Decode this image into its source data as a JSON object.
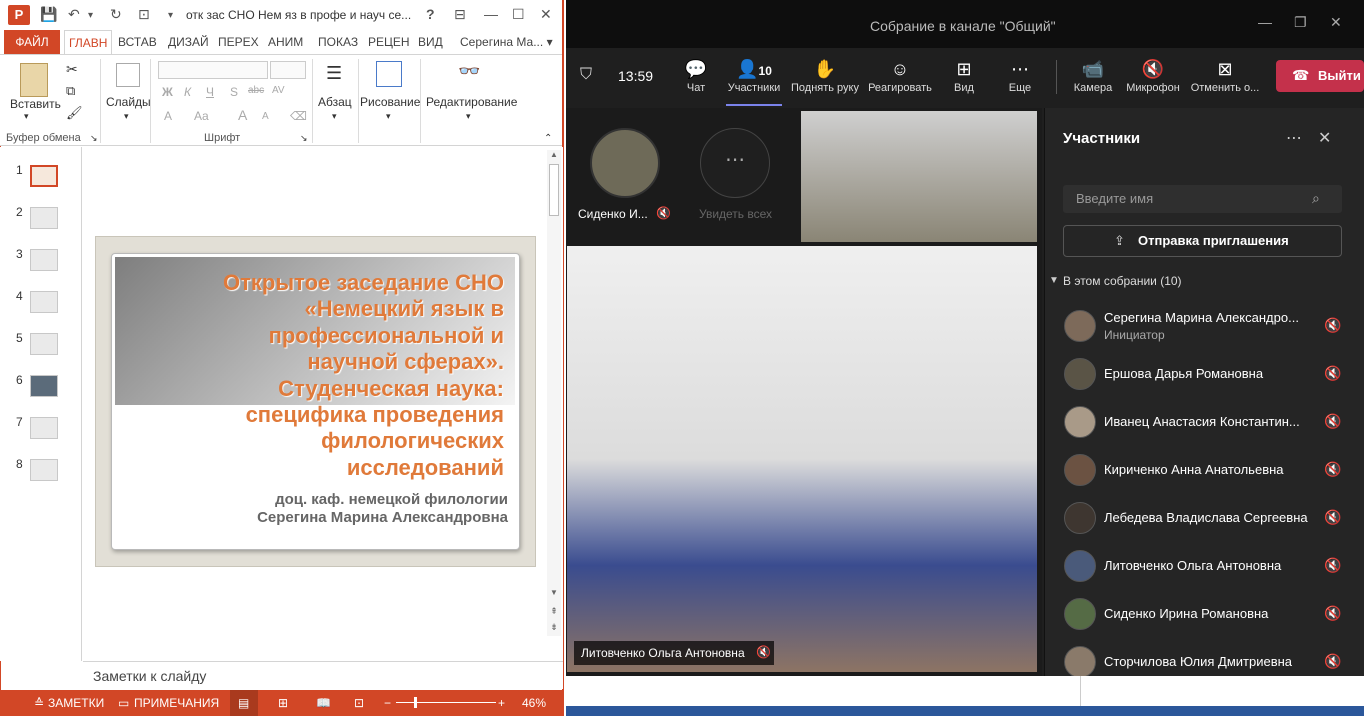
{
  "ppt": {
    "doc_title": "отк зас СНО Нем яз в профе и науч се...",
    "help": "?",
    "tabs": [
      "ФАЙЛ",
      "ГЛАВН",
      "ВСТАВ",
      "ДИЗАЙ",
      "ПЕРЕХ",
      "АНИМ",
      "ПОКАЗ",
      "РЕЦЕН",
      "ВИД"
    ],
    "user": "Серегина Ма...",
    "ribbon": {
      "paste": "Вставить",
      "slides": "Слайды",
      "paragraph": "Абзац",
      "drawing": "Рисование",
      "editing": "Редактирование",
      "group_clipboard": "Буфер обмена",
      "group_font": "Шрифт",
      "font_buttons": [
        "Ж",
        "К",
        "Ч",
        "S",
        "abc",
        "AV",
        "A",
        "Aa",
        "A",
        "A"
      ]
    },
    "thumbnails": [
      "1",
      "2",
      "3",
      "4",
      "5",
      "6",
      "7",
      "8"
    ],
    "slide": {
      "title_lines": [
        "Открытое заседание СНО",
        "«Немецкий язык в",
        "профессиональной и",
        "научной сферах».",
        "Студенческая наука:",
        "специфика проведения",
        "филологических",
        "исследований"
      ],
      "sub1": "доц. каф. немецкой филологии",
      "sub2": "Серегина Марина Александровна"
    },
    "notes_placeholder": "Заметки к слайду",
    "status": {
      "notes": "ЗАМЕТКИ",
      "comments": "ПРИМЕЧАНИЯ",
      "zoom": "46%"
    }
  },
  "teams": {
    "title": "Собрание в канале \"Общий\"",
    "time": "13:59",
    "participants_count": "10",
    "toolbar": [
      "Чат",
      "Участники",
      "Поднять руку",
      "Реагировать",
      "Вид",
      "Еще",
      "Камера",
      "Микрофон",
      "Отменить о..."
    ],
    "leave": "Выйти",
    "tiles": {
      "sidenko": "Сиденко И...",
      "see_all": "Увидеть всех",
      "main_name": "Литовченко Ольга Антоновна"
    },
    "panel": {
      "title": "Участники",
      "search_placeholder": "Введите имя",
      "invite": "Отправка приглашения",
      "section": "В этом собрании (10)",
      "people": [
        {
          "name": "Серегина Марина Александро...",
          "role": "Инициатор"
        },
        {
          "name": "Ершова Дарья Романовна"
        },
        {
          "name": "Иванец Анастасия Константин..."
        },
        {
          "name": "Кириченко Анна Анатольевна"
        },
        {
          "name": "Лебедева Владислава Сергеевна"
        },
        {
          "name": "Литовченко Ольга Антоновна"
        },
        {
          "name": "Сиденко Ирина Романовна"
        },
        {
          "name": "Сторчилова Юлия Дмитриевна"
        }
      ]
    }
  }
}
